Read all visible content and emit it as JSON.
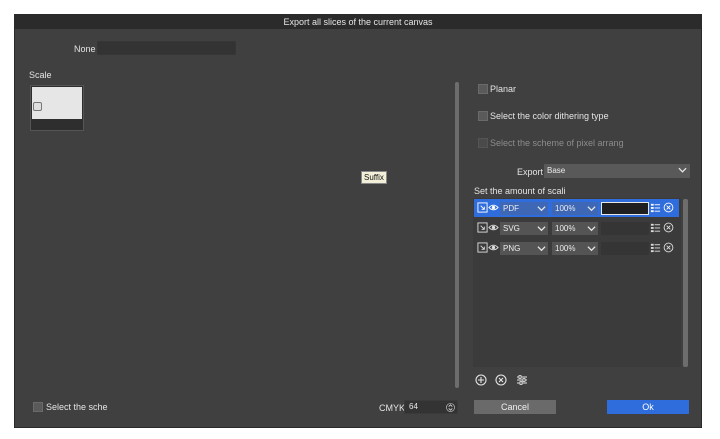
{
  "dialog": {
    "title": "Export all slices of the current canvas",
    "none_label": "None",
    "scale_label": "Scale",
    "tooltip": "Suffix",
    "options": {
      "planar": "Planar",
      "dithering": "Select the color dithering type",
      "pixel_scheme": "Select the scheme of pixel arrang"
    },
    "export_label": "Export",
    "export_value": "Base",
    "scale_list_label": "Set the amount of scali",
    "rows": [
      {
        "format": "PDF",
        "scale": "100%"
      },
      {
        "format": "SVG",
        "scale": "100%"
      },
      {
        "format": "PNG",
        "scale": "100%"
      }
    ],
    "bottom_checkbox_label": "Select the sche",
    "cmyk_label": "CMYK",
    "cmyk_value": "64",
    "cancel_label": "Cancel",
    "ok_label": "Ok"
  },
  "colors": {
    "accent": "#2f6ddd",
    "panel": "#404040",
    "titlebar": "#2b2b2b"
  },
  "icons": [
    "slice-export-icon",
    "eye-icon",
    "chevron-down-icon",
    "list-settings-icon",
    "remove-circle-icon",
    "add-circle-icon",
    "sliders-icon",
    "spinner-arrows-icon"
  ]
}
